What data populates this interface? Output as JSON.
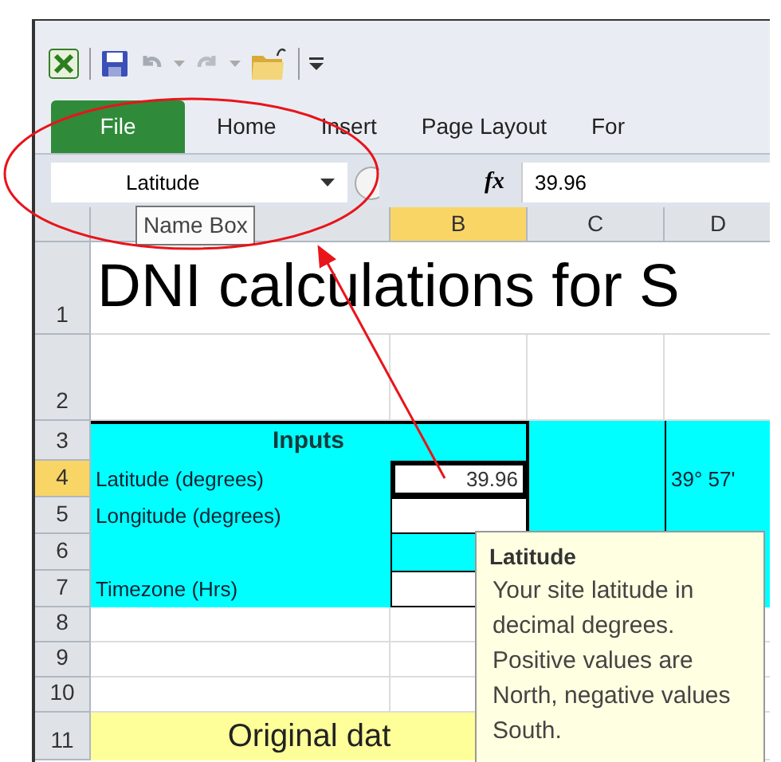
{
  "ribbon_tabs": [
    {
      "label": "File",
      "kind": "file"
    },
    {
      "label": "Home",
      "kind": "tab"
    },
    {
      "label": "Insert",
      "kind": "tab"
    },
    {
      "label": "Page Layout",
      "kind": "tab"
    },
    {
      "label": "For",
      "kind": "tab"
    }
  ],
  "formula_bar": {
    "name_box": "Latitude",
    "formula_label": "fx",
    "value": "39.96"
  },
  "name_box_tooltip": "Name Box",
  "columns": [
    {
      "label": "B",
      "selected": true
    },
    {
      "label": "C",
      "selected": false
    },
    {
      "label": "D",
      "selected": false
    }
  ],
  "rows": [
    {
      "number": "1",
      "selected": false,
      "cells": [
        {
          "kind": "title",
          "text": "DNI calculations for S"
        }
      ]
    },
    {
      "number": "2",
      "selected": false,
      "cells": [
        {
          "kind": "blank"
        },
        {
          "kind": "blank"
        },
        {
          "kind": "blank"
        },
        {
          "kind": "blank"
        }
      ]
    },
    {
      "number": "3",
      "selected": false,
      "cells": [
        {
          "kind": "heading",
          "text": "Inputs"
        },
        {
          "kind": "fill"
        },
        {
          "kind": "fill"
        }
      ]
    },
    {
      "number": "4",
      "selected": true,
      "cells": [
        {
          "kind": "label",
          "text": "Latitude (degrees)"
        },
        {
          "kind": "input",
          "text": "39.96",
          "selected": true
        },
        {
          "kind": "fill"
        },
        {
          "kind": "fill",
          "text": "39° 57'"
        }
      ]
    },
    {
      "number": "5",
      "selected": false,
      "cells": [
        {
          "kind": "label",
          "text": "Longitude (degrees)"
        },
        {
          "kind": "input",
          "selected": false
        },
        {
          "kind": "fill"
        },
        {
          "kind": "fill"
        }
      ]
    },
    {
      "number": "6",
      "selected": false,
      "cells": [
        {
          "kind": "label"
        },
        {
          "kind": "fill"
        },
        {
          "kind": "covered"
        },
        {
          "kind": "fill"
        }
      ]
    },
    {
      "number": "7",
      "selected": false,
      "cells": [
        {
          "kind": "label",
          "text": "Timezone (Hrs)"
        },
        {
          "kind": "input",
          "selected": false
        },
        {
          "kind": "covered"
        },
        {
          "kind": "fill"
        }
      ]
    },
    {
      "number": "8",
      "selected": false,
      "cells": [
        {
          "kind": "blank"
        },
        {
          "kind": "blank"
        },
        {
          "kind": "covered"
        },
        {
          "kind": "blank"
        }
      ]
    },
    {
      "number": "9",
      "selected": false,
      "cells": [
        {
          "kind": "blank"
        },
        {
          "kind": "blank"
        },
        {
          "kind": "covered"
        },
        {
          "kind": "blank"
        }
      ]
    },
    {
      "number": "10",
      "selected": false,
      "cells": [
        {
          "kind": "blank"
        },
        {
          "kind": "blank"
        },
        {
          "kind": "blank"
        },
        {
          "kind": "blank"
        }
      ]
    },
    {
      "number": "11",
      "selected": false,
      "cells": [
        {
          "kind": "band",
          "text": "Original dat"
        },
        {
          "kind": "blank"
        },
        {
          "kind": "blank"
        }
      ]
    }
  ],
  "cell_tooltip": {
    "title": "Latitude",
    "text": "Your site latitude in decimal degrees. Positive values are North, negative values South."
  }
}
